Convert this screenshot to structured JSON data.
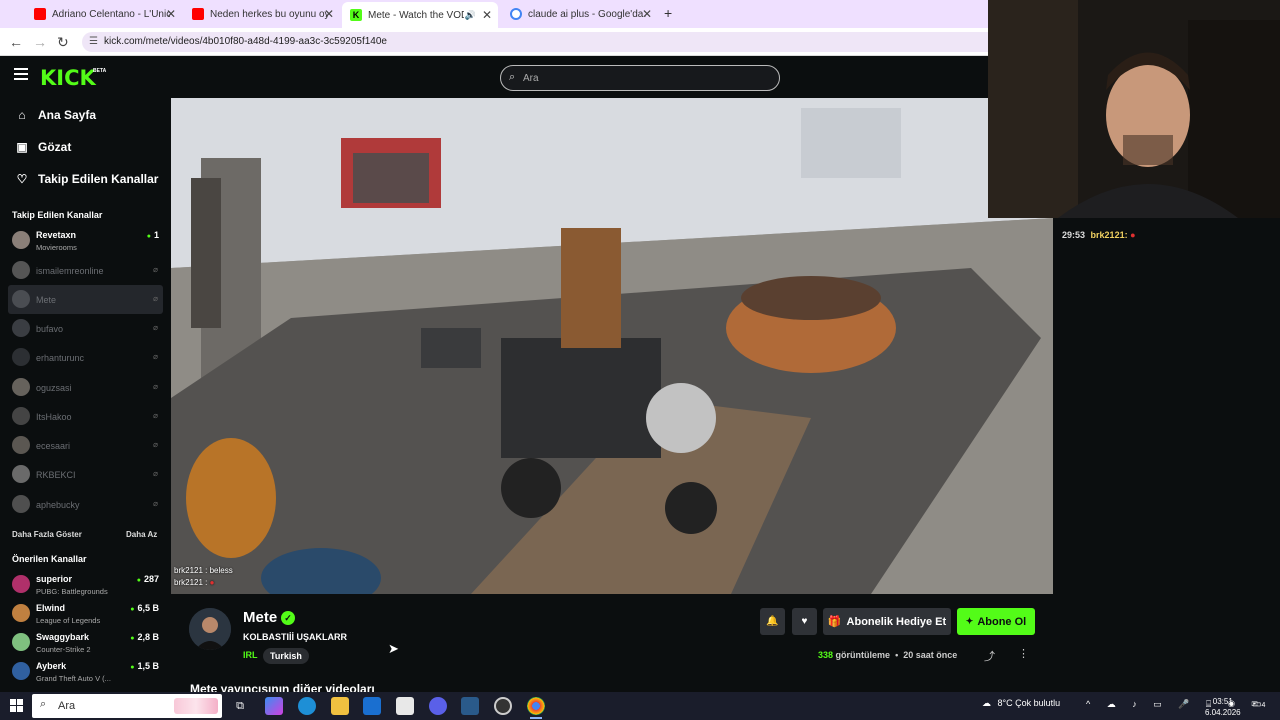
{
  "browser": {
    "tabs": [
      {
        "title": "Adriano Celentano - L'Unica Chi",
        "favicon": "youtube-icon",
        "color": "#ff0000"
      },
      {
        "title": "Neden herkes bu oyunu oynam",
        "favicon": "youtube-icon",
        "color": "#ff0000"
      },
      {
        "title": "Mete - Watch the VOD on K",
        "favicon": "kick-icon",
        "color": "#53fc18"
      },
      {
        "title": "claude ai plus - Google'da Ara",
        "favicon": "google-icon",
        "color": "#4285f4"
      }
    ],
    "new_tab": "+",
    "url": "kick.com/mete/videos/4b010f80-a48d-4199-aa3c-3c59205f140e"
  },
  "header": {
    "logo": "KICK",
    "logo_badge": "BETA",
    "search_placeholder": "Ara"
  },
  "sidebar": {
    "nav": [
      {
        "label": "Ana Sayfa",
        "icon": "home-icon"
      },
      {
        "label": "Gözat",
        "icon": "browse-icon"
      },
      {
        "label": "Takip Edilen Kanallar",
        "icon": "heart-icon"
      }
    ],
    "followed_title": "Takip Edilen Kanallar",
    "followed": [
      {
        "name": "Revetaxn",
        "sub": "Movierooms",
        "viewers": "1",
        "live": true
      },
      {
        "name": "ismailemreonline",
        "live": false
      },
      {
        "name": "Mete",
        "live": false
      },
      {
        "name": "bufavo",
        "live": false
      },
      {
        "name": "erhanturunc",
        "live": false
      },
      {
        "name": "oguzsasi",
        "live": false
      },
      {
        "name": "ItsHakoo",
        "live": false
      },
      {
        "name": "ecesaari",
        "live": false
      },
      {
        "name": "RKBEKCI",
        "live": false
      },
      {
        "name": "aphebucky",
        "live": false
      }
    ],
    "show_more": "Daha Fazla Göster",
    "show_less": "Daha Az",
    "recommended_title": "Önerilen Kanallar",
    "recommended": [
      {
        "name": "superior",
        "sub": "PUBG: Battlegrounds",
        "viewers": "287"
      },
      {
        "name": "Elwind",
        "sub": "League of Legends",
        "viewers": "6,5 B"
      },
      {
        "name": "Swaggybark",
        "sub": "Counter-Strike 2",
        "viewers": "2,8 B"
      },
      {
        "name": "Ayberk",
        "sub": "Grand Theft Auto V (...",
        "viewers": "1,5 B"
      }
    ]
  },
  "video": {
    "chat_overlay": [
      {
        "user": "brk2121",
        "text": "beless"
      },
      {
        "user": "brk2121",
        "text": ""
      }
    ]
  },
  "chat": {
    "message": {
      "time": "29:53",
      "user": "brk2121:"
    }
  },
  "channel": {
    "name": "Mete",
    "title": "KOLBASTIİİ UŞAKLARR",
    "category": "IRL",
    "tag": "Turkish",
    "gift_button": "Abonelik Hediye Et",
    "subscribe_button": "Abone Ol",
    "views": "338",
    "views_label": "görüntüleme",
    "age": "20 saat önce",
    "other_videos_title": "Mete yayıncısının diğer videoları"
  },
  "taskbar": {
    "search_placeholder": "Ara",
    "weather": "8°C  Çok bulutlu",
    "time": "03:51",
    "date": "6.04.2026",
    "notifications": "4"
  }
}
